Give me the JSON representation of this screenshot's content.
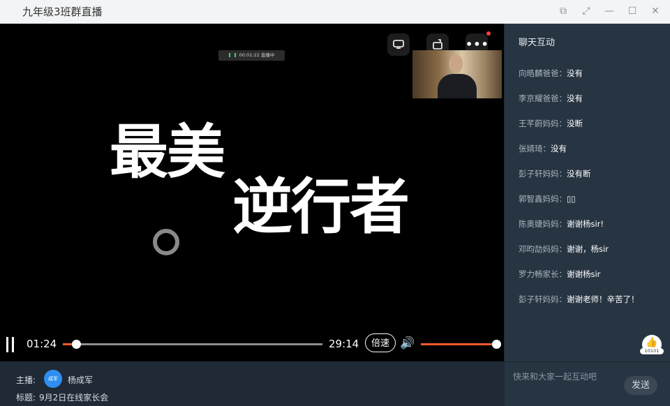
{
  "window": {
    "title": "九年级3班群直播"
  },
  "player": {
    "live_badge_time": "00:01:22",
    "live_badge_status": "直播中",
    "slide_line1": "最美",
    "slide_line2": "逆行者",
    "current_time": "01:24",
    "total_time": "29:14",
    "speed_label": "倍速",
    "progress_fraction": 0.05,
    "volume_fraction": 1.0
  },
  "chat": {
    "title": "聊天互动",
    "messages": [
      {
        "name": "向皓麟爸爸：",
        "text": "没有"
      },
      {
        "name": "李京耀爸爸：",
        "text": "没有"
      },
      {
        "name": "王芊蔚妈妈：",
        "text": "没断"
      },
      {
        "name": "张婧琦：",
        "text": "没有"
      },
      {
        "name": "彭子轩妈妈：",
        "text": "没有断"
      },
      {
        "name": "郭智鑫妈妈：",
        "text": "▯▯"
      },
      {
        "name": "陈奥婕妈妈：",
        "text": "谢谢杨sir!"
      },
      {
        "name": "邓昀劼妈妈：",
        "text": "谢谢，杨sir"
      },
      {
        "name": "罗力畅家长：",
        "text": "谢谢杨sir"
      },
      {
        "name": "彭子轩妈妈：",
        "text": "谢谢老师！辛苦了！"
      }
    ],
    "like_count": "10101",
    "input_placeholder": "快来和大家一起互动吧",
    "send_label": "发送"
  },
  "footer": {
    "host_label": "主播:",
    "host_avatar_text": "成军",
    "host_name": "杨成军",
    "topic_label": "标题:",
    "topic_text": "9月2日在线家长会"
  },
  "colors": {
    "accent": "#f05a28",
    "avatar": "#2f8ef0",
    "chat_bg": "#273543"
  }
}
